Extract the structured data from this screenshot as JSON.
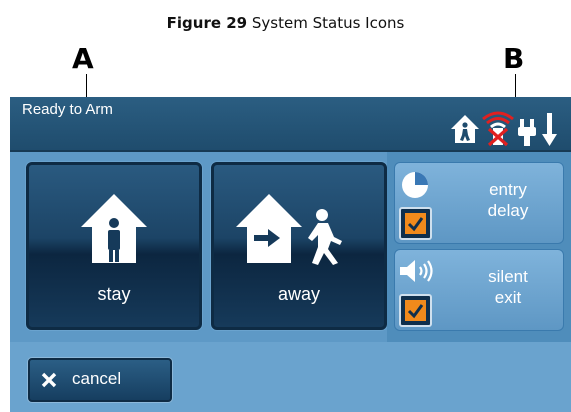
{
  "caption": {
    "figure": "Figure 29",
    "title": "System Status Icons"
  },
  "callouts": {
    "a": "A",
    "b": "B"
  },
  "status_bar": {
    "text": "Ready to Arm",
    "icons": [
      "person-home-icon",
      "wifi-disconnected-icon",
      "power-plug-icon",
      "arrow-down-icon"
    ]
  },
  "arm_buttons": {
    "stay": "stay",
    "away": "away"
  },
  "options": {
    "entry_delay": {
      "label_line1": "entry",
      "label_line2": "delay",
      "checked": true,
      "icon": "clock-icon"
    },
    "silent_exit": {
      "label_line1": "silent",
      "label_line2": "exit",
      "checked": true,
      "icon": "speaker-icon"
    }
  },
  "cancel": {
    "label": "cancel",
    "icon": "close-icon"
  },
  "colors": {
    "status_bar": "#1f4c6d",
    "screen_bg": "#6aa3ce",
    "check_accent": "#f08a1c",
    "alert_red": "#e02020"
  }
}
